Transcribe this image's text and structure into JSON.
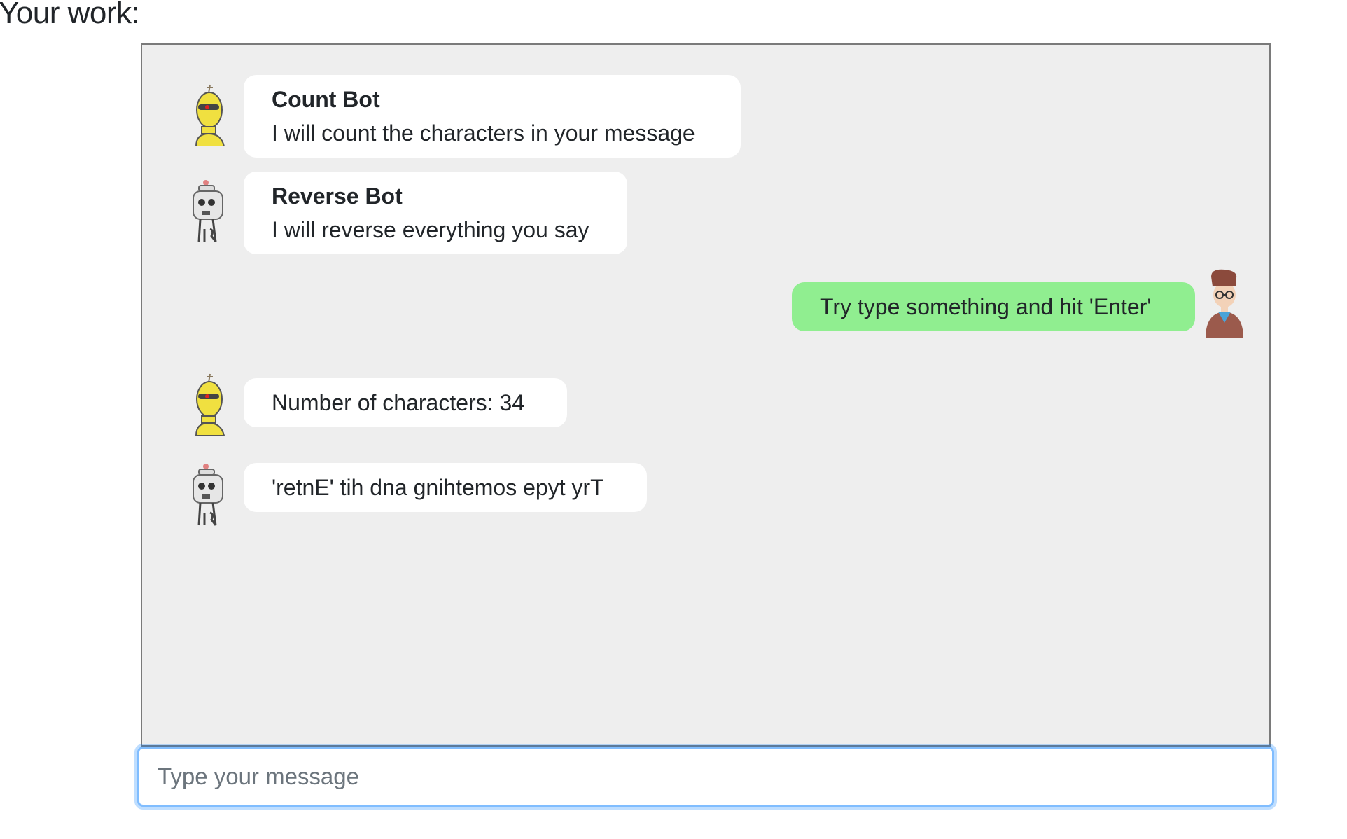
{
  "page": {
    "heading": "Your work:"
  },
  "chat": {
    "messages": [
      {
        "sender": "Count Bot",
        "text": "I will count the characters in your message",
        "from": "bot",
        "avatar": "count-bot-avatar"
      },
      {
        "sender": "Reverse Bot",
        "text": "I will reverse everything you say",
        "from": "bot",
        "avatar": "reverse-bot-avatar"
      },
      {
        "sender": "",
        "text": "Try type something and hit 'Enter'",
        "from": "user",
        "avatar": "user-avatar"
      },
      {
        "sender": "",
        "text": "Number of characters: 34",
        "from": "bot",
        "avatar": "count-bot-avatar"
      },
      {
        "sender": "",
        "text": "'retnE' tih dna gnihtemos epyt yrT",
        "from": "bot",
        "avatar": "reverse-bot-avatar"
      }
    ],
    "colors": {
      "panel_bg": "#eeeeee",
      "bot_bubble": "#ffffff",
      "user_bubble": "#90ee90",
      "input_focus": "#80bdff"
    }
  },
  "input": {
    "placeholder": "Type your message",
    "value": ""
  }
}
